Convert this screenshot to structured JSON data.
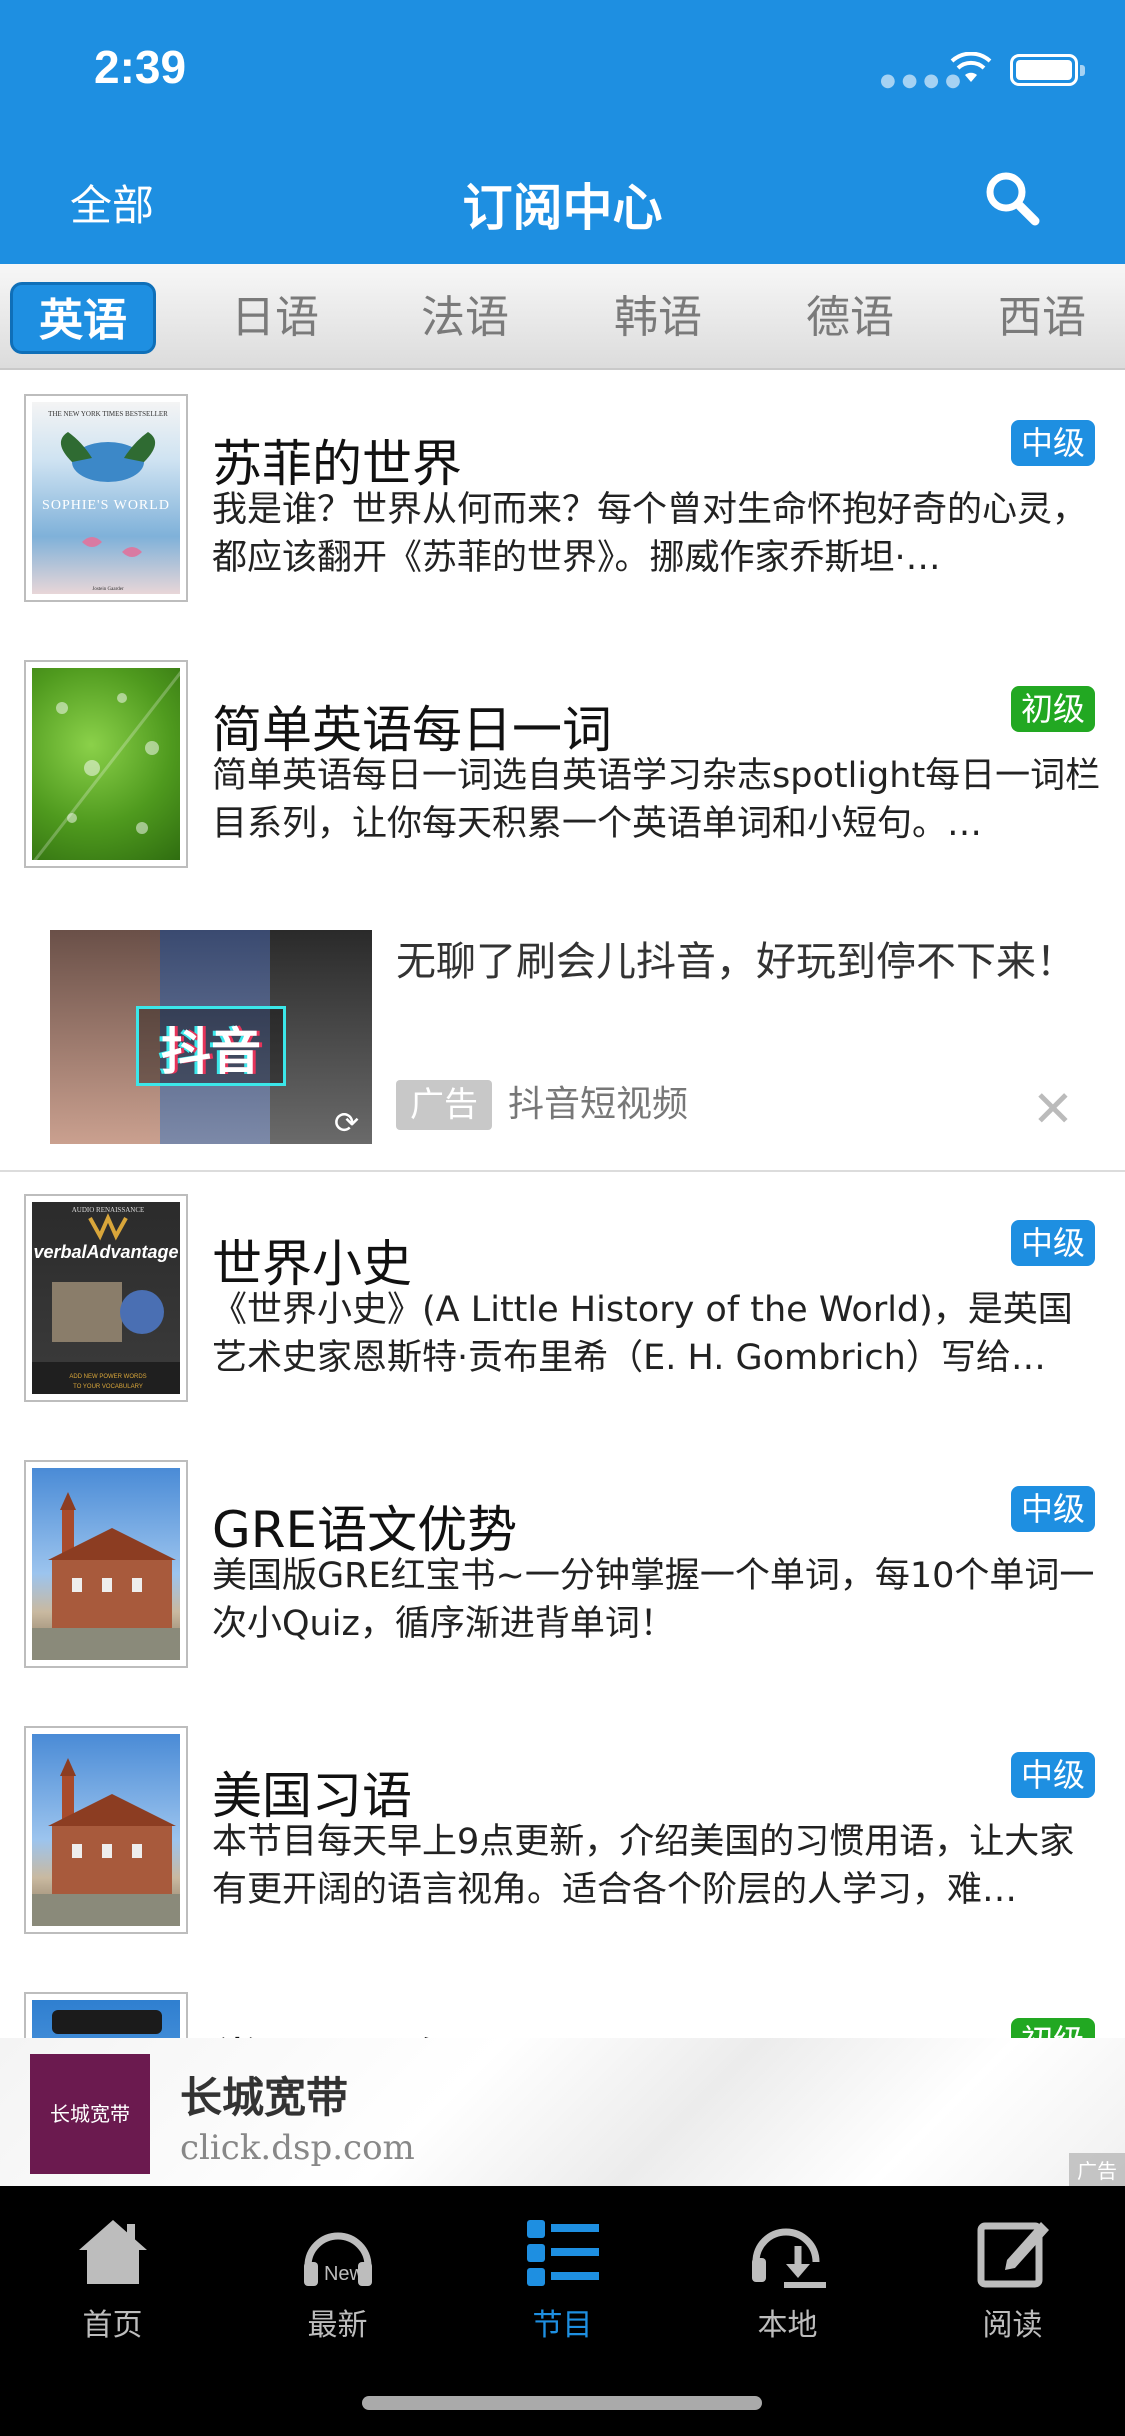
{
  "status_bar": {
    "time": "2:39"
  },
  "nav": {
    "left_label": "全部",
    "title": "订阅中心"
  },
  "tabs": [
    "英语",
    "日语",
    "法语",
    "韩语",
    "德语",
    "西语"
  ],
  "items": [
    {
      "title": "苏菲的世界",
      "level": "中级",
      "desc": "我是谁？世界从何而来？每个曾对生命怀抱好奇的心灵，都应该翻开《苏菲的世界》。挪威作家乔斯坦·…",
      "cover_text": "SOPHIE'S WORLD"
    },
    {
      "title": "简单英语每日一词",
      "level": "初级",
      "desc": "简单英语每日一词选自英语学习杂志spotlight每日一词栏目系列，让你每天积累一个英语单词和小短句。…"
    },
    {
      "title": "世界小史",
      "level": "中级",
      "desc": "《世界小史》(A Little History of the World)，是英国艺术史家恩斯特·贡布里希（E. H. Gombrich）写给…",
      "cover_text": "verbalAdvantage"
    },
    {
      "title": "GRE语文优势",
      "level": "中级",
      "desc": "美国版GRE红宝书~一分钟掌握一个单词，每10个单词一次小Quiz，循序渐进背单词！"
    },
    {
      "title": "美国习语",
      "level": "中级",
      "desc": "本节目每天早上9点更新，介绍美国的习惯用语，让大家有更开阔的语言视角。适合各个阶层的人学习，难…"
    },
    {
      "title": "常用口语俚语",
      "level": "初级",
      "desc": ""
    }
  ],
  "ad": {
    "title": "无聊了刷会儿抖音，好玩到停不下来！",
    "badge": "广告",
    "source": "抖音短视频",
    "image_text": "抖音"
  },
  "banner": {
    "title": "长城宽带",
    "url": "click.dsp.com",
    "tag": "广告",
    "logo_text": "长城宽带"
  },
  "tabbar": [
    {
      "label": "首页",
      "icon": "home-icon"
    },
    {
      "label": "最新",
      "icon": "headphones-new-icon"
    },
    {
      "label": "节目",
      "icon": "list-icon"
    },
    {
      "label": "本地",
      "icon": "headphones-download-icon"
    },
    {
      "label": "阅读",
      "icon": "edit-icon"
    }
  ],
  "colors": {
    "primary": "#1e8fe1",
    "level_intermediate": "#1e8fe1",
    "level_beginner": "#22a822",
    "tabbar_bg": "#000000"
  }
}
